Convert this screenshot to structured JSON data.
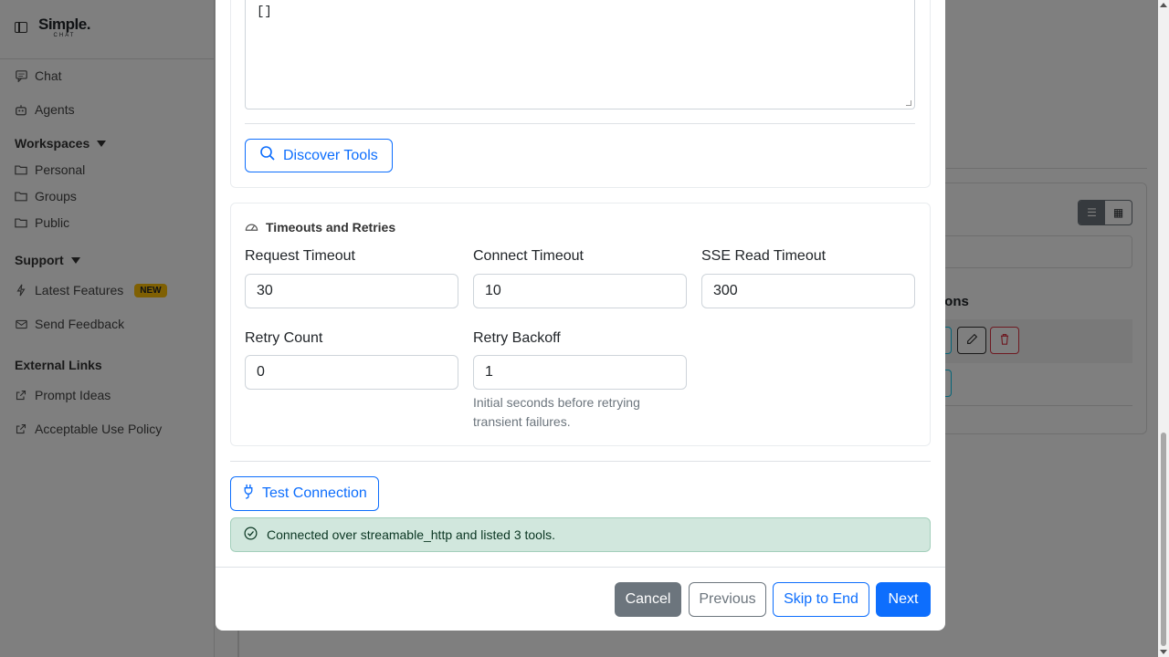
{
  "sidebar": {
    "logo_main": "Simple.",
    "logo_sub": "CHAT",
    "items": [
      {
        "label": "Chat",
        "icon": "chat-icon"
      },
      {
        "label": "Agents",
        "icon": "robot-icon"
      }
    ],
    "workspaces_heading": "Workspaces",
    "workspaces": [
      {
        "label": "Personal",
        "icon": "folder-icon"
      },
      {
        "label": "Groups",
        "icon": "folder-icon"
      },
      {
        "label": "Public",
        "icon": "folder-icon"
      }
    ],
    "support_heading": "Support",
    "support": [
      {
        "label": "Latest Features",
        "icon": "lightning-icon",
        "badge": "NEW"
      },
      {
        "label": "Send Feedback",
        "icon": "envelope-icon"
      }
    ],
    "external_heading": "External Links",
    "external": [
      {
        "label": "Prompt Ideas",
        "icon": "external-link-icon"
      },
      {
        "label": "Acceptable Use Policy",
        "icon": "external-link-icon"
      }
    ]
  },
  "background": {
    "section_heading_partial": "ions"
  },
  "modal": {
    "textarea_value": "[]",
    "discover_tools_label": "Discover Tools",
    "timeouts": {
      "title": "Timeouts and Retries",
      "request_timeout_label": "Request Timeout",
      "request_timeout_value": "30",
      "connect_timeout_label": "Connect Timeout",
      "connect_timeout_value": "10",
      "sse_read_timeout_label": "SSE Read Timeout",
      "sse_read_timeout_value": "300",
      "retry_count_label": "Retry Count",
      "retry_count_value": "0",
      "retry_backoff_label": "Retry Backoff",
      "retry_backoff_value": "1",
      "retry_backoff_help": "Initial seconds before retrying transient failures."
    },
    "test_connection_label": "Test Connection",
    "status_message": "Connected over streamable_http and listed 3 tools.",
    "footer": {
      "cancel": "Cancel",
      "previous": "Previous",
      "skip": "Skip to End",
      "next": "Next"
    }
  },
  "colors": {
    "primary": "#0d6efd",
    "secondary": "#6c757d",
    "success_bg": "#d1e7dd",
    "badge": "#ffc107"
  }
}
